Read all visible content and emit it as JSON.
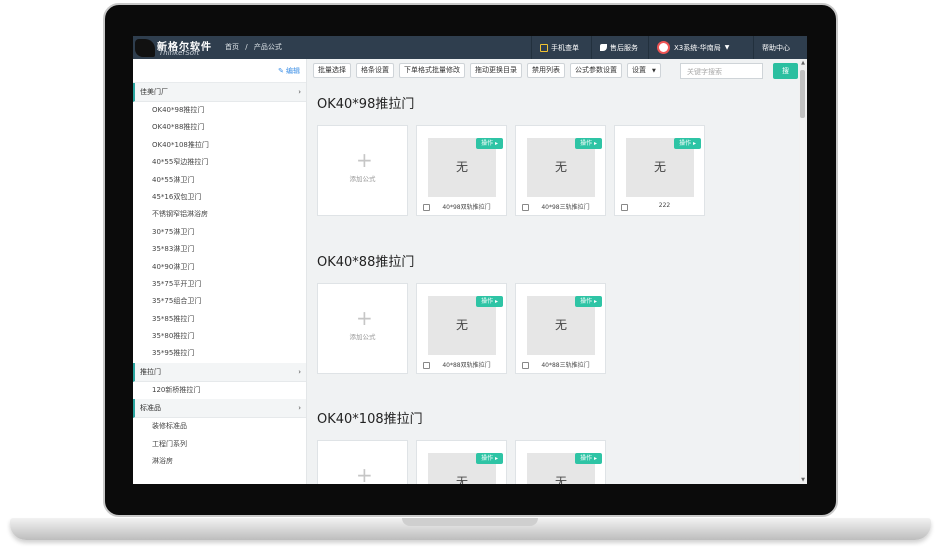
{
  "header": {
    "logo_cn": "新格尔软件",
    "logo_en": "ThinkerSoft",
    "breadcrumb": [
      "首页",
      "/",
      "产品公式"
    ],
    "mobile_order": "手机查单",
    "after_sales": "售后服务",
    "user": "X3系统-华南局",
    "help": "帮助中心"
  },
  "sidebar": {
    "edit_label": "编辑",
    "groups": [
      {
        "label": "佳美门厂",
        "items": [
          "OK40*98推拉门",
          "OK40*88推拉门",
          "OK40*108推拉门",
          "40*55窄边推拉门",
          "40*55淋卫门",
          "45*16双包卫门",
          "不锈钢窄铝淋浴房",
          "30*75淋卫门",
          "35*83淋卫门",
          "40*90淋卫门",
          "35*75平开卫门",
          "35*75组合卫门",
          "35*85推拉门",
          "35*80推拉门",
          "35*95推拉门"
        ]
      },
      {
        "label": "推拉门",
        "items": [
          "120新桥推拉门"
        ]
      },
      {
        "label": "标准品",
        "items": [
          "装修标准品",
          "工程门系列",
          "淋浴房"
        ]
      }
    ]
  },
  "toolbar": {
    "buttons": [
      "批量选择",
      "格条设置",
      "下单格式批量修改",
      "拖动更换目录",
      "禁用列表",
      "公式参数设置",
      "设置"
    ],
    "search_placeholder": "关键字搜索",
    "search_button": "搜"
  },
  "content": {
    "add_label": "添加公式",
    "op_label": "操作",
    "placeholder_text": "无",
    "sections": [
      {
        "title": "OK40*98推拉门",
        "cards": [
          "40*98双轨推拉门",
          "40*98三轨推拉门",
          "222"
        ]
      },
      {
        "title": "OK40*88推拉门",
        "cards": [
          "40*88双轨推拉门",
          "40*88三轨推拉门"
        ]
      },
      {
        "title": "OK40*108推拉门",
        "cards": [
          "",
          ""
        ]
      }
    ]
  }
}
